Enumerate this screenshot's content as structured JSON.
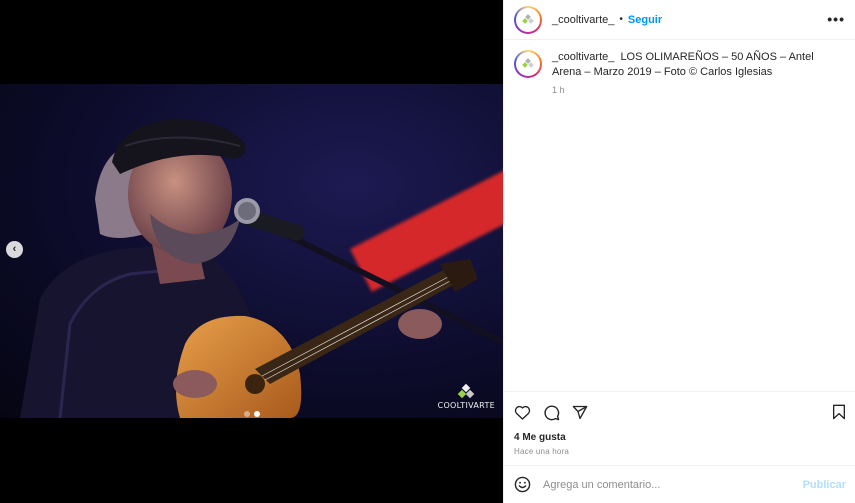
{
  "post": {
    "username": "_cooltivarte_",
    "separator": "•",
    "follow_label": "Seguir",
    "more_label": "•••",
    "caption": "LOS OLIMAREÑOS – 50 AÑOS – Antel Arena – Marzo 2019 – Foto © Carlos Iglesias",
    "caption_time": "1 h",
    "likes": "4 Me gusta",
    "time_ago": "Hace una hora",
    "image_watermark": "COOLTIVARTE",
    "carousel": {
      "total": 2,
      "active": 1
    }
  },
  "comment": {
    "placeholder": "Agrega un comentario...",
    "publish_label": "Publicar"
  },
  "icons": {
    "prev": "chevron-left-icon",
    "emoji": "emoji-icon",
    "like": "heart-icon",
    "comment": "comment-icon",
    "share": "share-icon",
    "save": "bookmark-icon"
  },
  "colors": {
    "accent": "#0095f6",
    "publish_disabled": "#b2dffc",
    "muted": "#8e8e8e"
  }
}
